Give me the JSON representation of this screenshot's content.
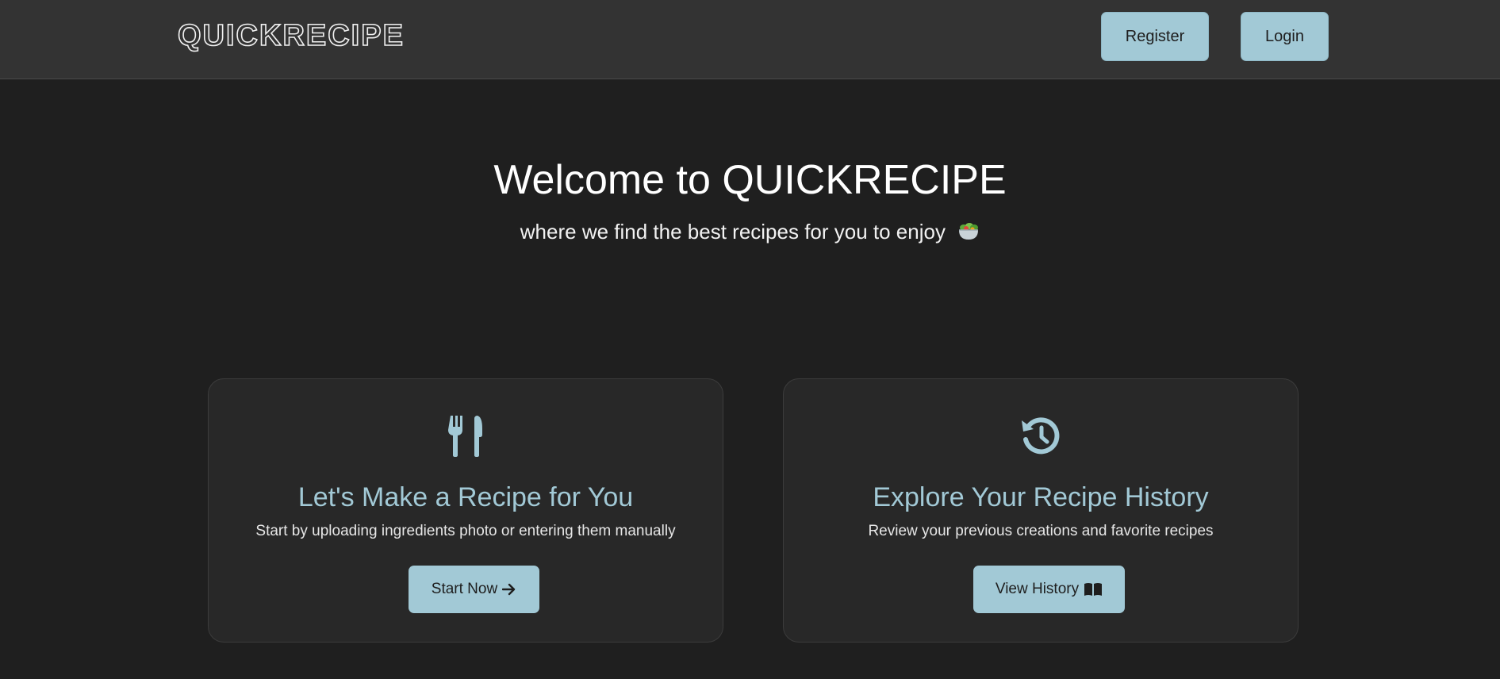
{
  "header": {
    "logo": "QUICKRECIPE",
    "register_label": "Register",
    "login_label": "Login"
  },
  "hero": {
    "title": "Welcome to QUICKRECIPE",
    "subtitle": "where we find the best recipes for you to enjoy",
    "subtitle_icon": "salad-bowl-icon"
  },
  "cards": [
    {
      "icon": "utensils-icon",
      "title": "Let's Make a Recipe for You",
      "description": "Start by uploading ingredients photo or entering them manually",
      "button_label": "Start Now",
      "button_icon": "arrow-right-icon"
    },
    {
      "icon": "history-icon",
      "title": "Explore Your Recipe History",
      "description": "Review your previous creations and favorite recipes",
      "button_label": "View History",
      "button_icon": "book-open-icon"
    }
  ],
  "colors": {
    "accent": "#a2c9d6",
    "background": "#1f1f1f",
    "navbar": "#333333",
    "card": "#282828"
  }
}
